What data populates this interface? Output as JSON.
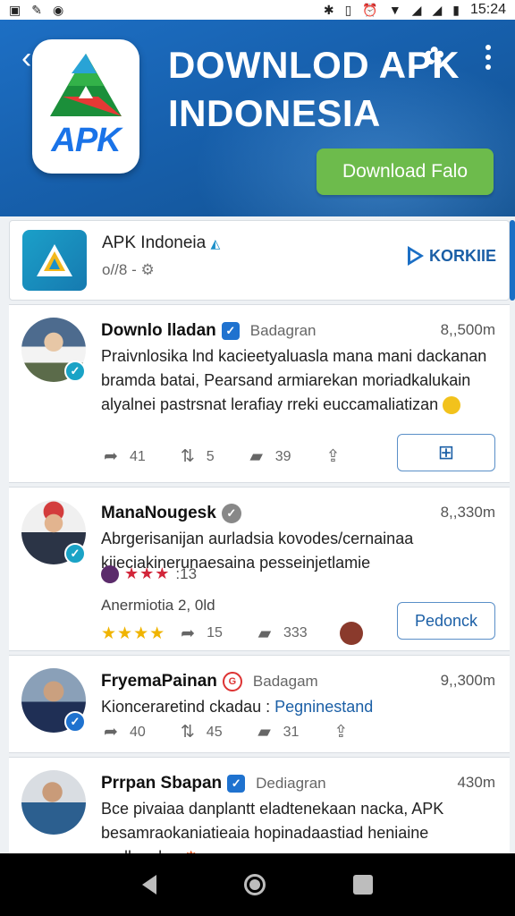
{
  "status_bar": {
    "left_icons": [
      "notification-icon",
      "edit-app-icon",
      "record-icon"
    ],
    "right_icons": [
      "bluetooth-icon",
      "vibrate-icon",
      "alarm-icon",
      "wifi-icon",
      "signal-icon",
      "signal-icon",
      "battery-icon"
    ],
    "time": "15:24"
  },
  "header": {
    "logo_text": "APK",
    "title": "DOWNLOD APK INDONESIA",
    "download_button": "Download Falo"
  },
  "app_row": {
    "name": "APK Indoneia",
    "meta": "o//8 -",
    "open_label": "KORKIIE"
  },
  "posts": [
    {
      "name": "Downlo lladan",
      "source": "Badagran",
      "count": "8,,500m",
      "body": "Praivnlosika lnd kacieetyaluasla mana mani dackanan bramda batai, Pearsand armiarekan moriadkalukain alyalnei pastrsnat lerafiay rreki euccamaliatizan",
      "actions": [
        {
          "icon": "like-icon",
          "count": "41"
        },
        {
          "icon": "repost-icon",
          "count": "5"
        },
        {
          "icon": "comment-icon",
          "count": "39"
        },
        {
          "icon": "share-icon",
          "count": ""
        }
      ],
      "button_icon": "bookmark-icon"
    },
    {
      "name": "ManaNougesk",
      "source": "",
      "count": "8,,330m",
      "body": "Abrgerisanijan aurladsia kovodes/cernainaa kiieciakinerunaesaina pesseinjetlamie",
      "rating_text": ":13",
      "stars_line": "Anermiotia 2, 0ld",
      "actions": [
        {
          "icon": "like-icon",
          "count": "15"
        },
        {
          "icon": "comment-icon",
          "count": "333"
        }
      ],
      "button_label": "Pedonck"
    },
    {
      "name": "FryemaPainan",
      "source": "Badagam",
      "count": "9,,300m",
      "body_prefix": "Kionceraretind ckadau :",
      "body_link": "Pegninestand",
      "actions": [
        {
          "icon": "like-icon",
          "count": "40"
        },
        {
          "icon": "repost-icon",
          "count": "45"
        },
        {
          "icon": "comment-icon",
          "count": "31"
        },
        {
          "icon": "share-icon",
          "count": ""
        }
      ]
    },
    {
      "name": "Prrpan Sbapan",
      "source": "Dediagran",
      "count": "430m",
      "body": "Bce pivaiaa danplantt eladtenekaan nacka, APK besamraokaniatieaia hopinadaastiad heniaine nadlenulan"
    }
  ]
}
